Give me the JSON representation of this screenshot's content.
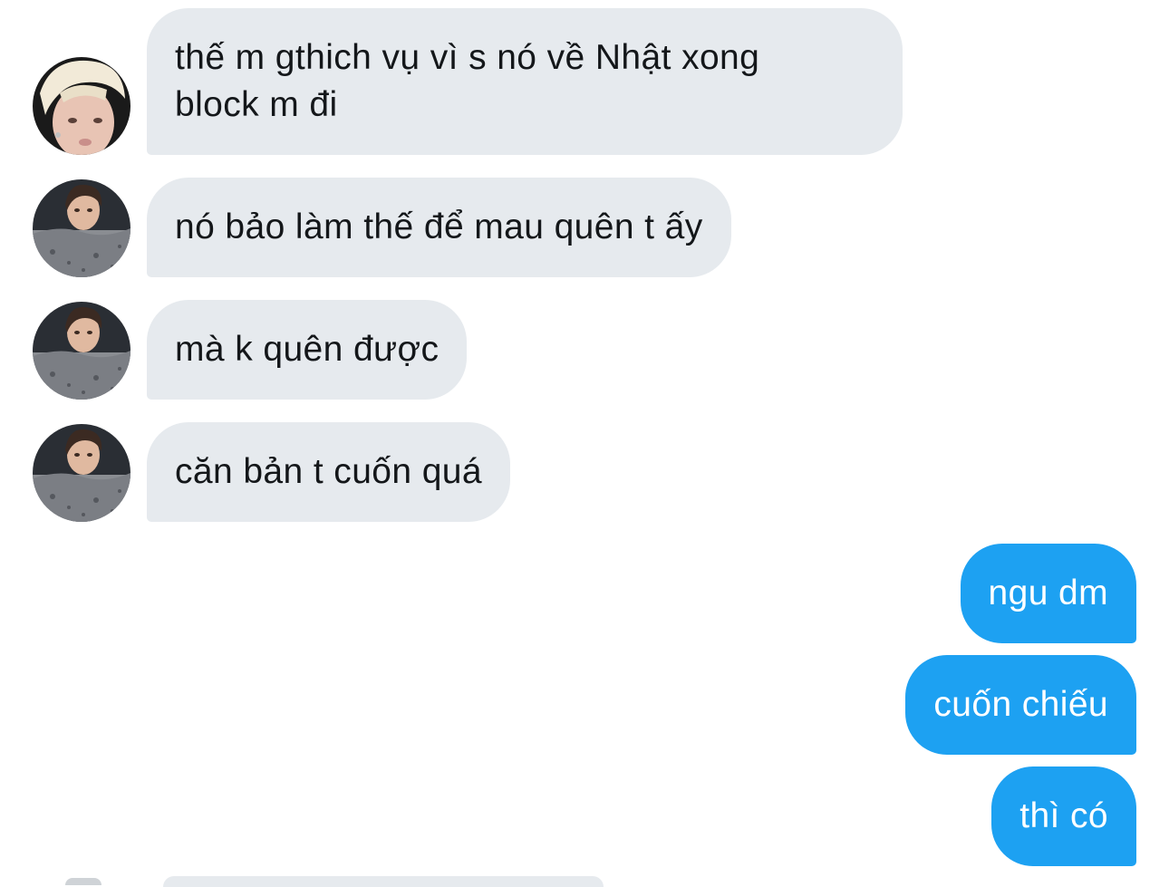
{
  "conversation": {
    "colors": {
      "incoming_bubble": "#e6eaee",
      "outgoing_bubble": "#1da1f2",
      "incoming_text": "#14171a",
      "outgoing_text": "#ffffff"
    },
    "messages": [
      {
        "direction": "incoming",
        "avatar": "avatar-blonde-photo",
        "text_line1": "thế m gthich vụ vì s nó về Nhật xong",
        "text_line2": "block m đi"
      },
      {
        "direction": "incoming",
        "avatar": "avatar-dark-hair-photo",
        "text": "nó bảo làm thế để mau quên t ấy"
      },
      {
        "direction": "incoming",
        "avatar": "avatar-dark-hair-photo",
        "text": "mà k quên được"
      },
      {
        "direction": "incoming",
        "avatar": "avatar-dark-hair-photo",
        "text": "căn bản t cuốn quá"
      },
      {
        "direction": "outgoing",
        "text": "ngu dm"
      },
      {
        "direction": "outgoing",
        "text": "cuốn chiếu"
      },
      {
        "direction": "outgoing",
        "text": "thì có"
      }
    ]
  }
}
